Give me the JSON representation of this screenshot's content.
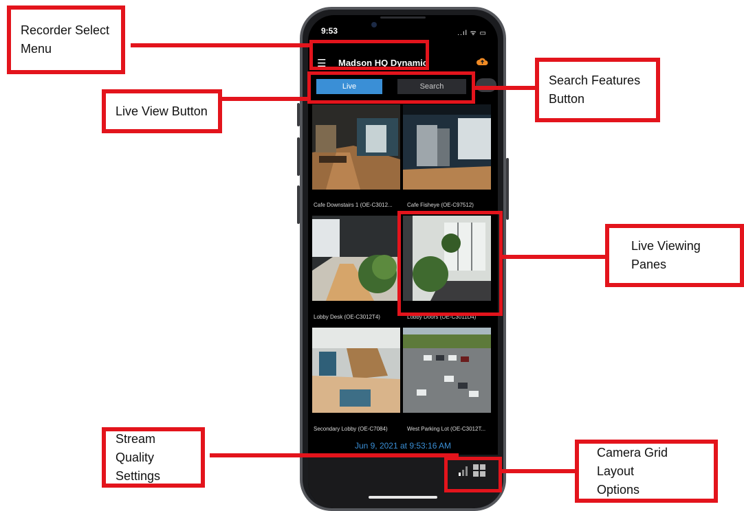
{
  "status_bar": {
    "time": "9:53",
    "icons": "..ıl ᯤ ▭"
  },
  "app": {
    "recorder_title": "Madson HQ Dynamic",
    "live_label": "Live",
    "search_label": "Search",
    "timestamp": "Jun 9, 2021 at 9:53:16 AM"
  },
  "cameras": [
    {
      "label": "Cafe Downstairs 1 (OE-C3012..."
    },
    {
      "label": "Cafe Fisheye (OE-C97512)"
    },
    {
      "label": "Lobby Desk (OE-C3012T4)"
    },
    {
      "label": "Lobby Doors (OE-C3011D4)"
    },
    {
      "label": "Secondary Lobby (OE-C7084)"
    },
    {
      "label": "West Parking Lot (OE-C3012T..."
    }
  ],
  "callouts": {
    "recorder_select": [
      "Recorder Select",
      "Menu"
    ],
    "live_view": [
      "Live View Button"
    ],
    "search_features": [
      "Search Features",
      "Button"
    ],
    "live_viewing_panes": [
      "Live Viewing Panes"
    ],
    "stream_quality": [
      "Stream Quality",
      "Settings"
    ],
    "grid_layout": [
      "Camera Grid Layout",
      "Options"
    ]
  },
  "colors": {
    "annotation_red": "#e3141c",
    "accent_blue": "#3a8fd6"
  }
}
